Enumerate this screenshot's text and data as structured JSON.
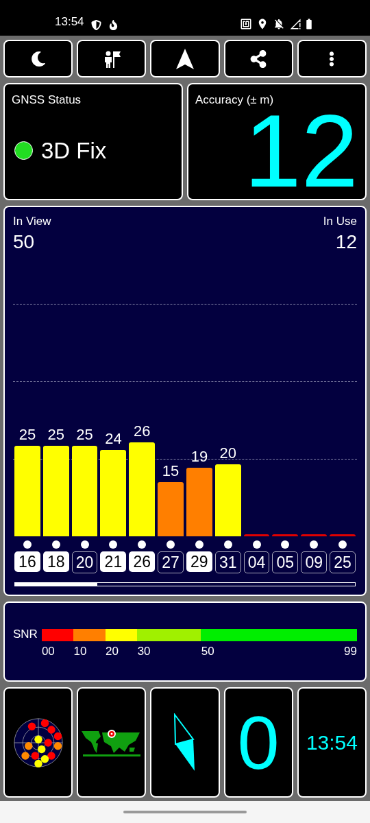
{
  "status_bar": {
    "time": "13:54"
  },
  "gnss_status": {
    "title": "GNSS Status",
    "fix": "3D Fix",
    "color": "#22dd22"
  },
  "accuracy": {
    "title": "Accuracy (± m)",
    "value": "12"
  },
  "satellites": {
    "in_view_label": "In View",
    "in_view": "50",
    "in_use_label": "In Use",
    "in_use": "12",
    "items": [
      {
        "id": "16",
        "snr": "25",
        "color": "#ffff00",
        "selected": true
      },
      {
        "id": "18",
        "snr": "25",
        "color": "#ffff00",
        "selected": true
      },
      {
        "id": "20",
        "snr": "25",
        "color": "#ffff00",
        "selected": false
      },
      {
        "id": "21",
        "snr": "24",
        "color": "#ffff00",
        "selected": true
      },
      {
        "id": "26",
        "snr": "26",
        "color": "#ffff00",
        "selected": true
      },
      {
        "id": "27",
        "snr": "15",
        "color": "#ff7f00",
        "selected": false
      },
      {
        "id": "29",
        "snr": "19",
        "color": "#ff7f00",
        "selected": true
      },
      {
        "id": "31",
        "snr": "20",
        "color": "#ffff00",
        "selected": false
      },
      {
        "id": "04",
        "color": "#e00000",
        "selected": false
      },
      {
        "id": "05",
        "color": "#e00000",
        "selected": false
      },
      {
        "id": "09",
        "color": "#e00000",
        "selected": false
      },
      {
        "id": "25",
        "color": "#e00000",
        "selected": false
      }
    ]
  },
  "snr_legend": {
    "label": "SNR",
    "segments": [
      {
        "label": "00",
        "color": "#ff0000"
      },
      {
        "label": "10",
        "color": "#ff7f00"
      },
      {
        "label": "20",
        "color": "#ffff00"
      },
      {
        "label": "30",
        "color": "#a0f000"
      },
      {
        "label": "50",
        "color": "#00ee00"
      }
    ],
    "end_label": "99"
  },
  "tiles": {
    "count": "0",
    "clock": "13:54"
  }
}
